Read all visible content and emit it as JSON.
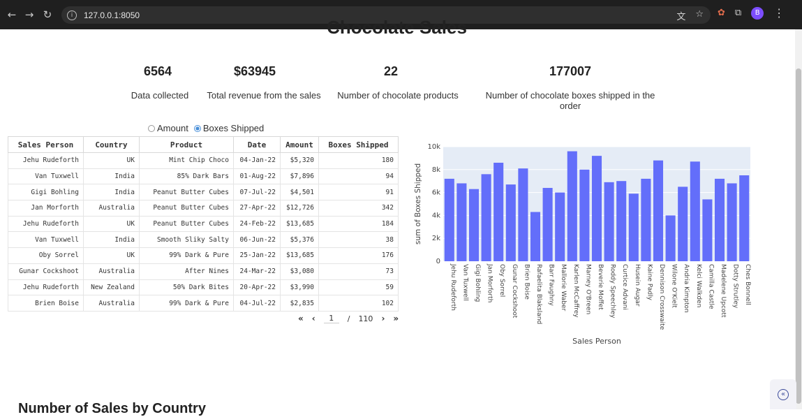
{
  "browser": {
    "url": "127.0.0.1:8050",
    "profile_initial": "B",
    "icons": [
      "back-icon",
      "forward-icon",
      "reload-icon",
      "info-icon",
      "translate-icon",
      "star-icon",
      "extension-icon",
      "puzzle-icon",
      "menu-icon"
    ]
  },
  "page": {
    "title": "Chocolate Sales",
    "bottom_heading": "Number of Sales by Country"
  },
  "stats": [
    {
      "value": "6564",
      "label": "Data collected"
    },
    {
      "value": "$63945",
      "label": "Total revenue from the sales"
    },
    {
      "value": "22",
      "label": "Number of chocolate products"
    },
    {
      "value": "177007",
      "label": "Number of chocolate boxes shipped in the order"
    }
  ],
  "radio": {
    "options": [
      "Amount",
      "Boxes Shipped"
    ],
    "selected": "Boxes Shipped"
  },
  "table": {
    "headers": [
      "Sales Person",
      "Country",
      "Product",
      "Date",
      "Amount",
      "Boxes Shipped"
    ],
    "rows": [
      [
        "Jehu Rudeforth",
        "UK",
        "Mint Chip Choco",
        "04-Jan-22",
        "$5,320",
        "180"
      ],
      [
        "Van Tuxwell",
        "India",
        "85% Dark Bars",
        "01-Aug-22",
        "$7,896",
        "94"
      ],
      [
        "Gigi Bohling",
        "India",
        "Peanut Butter Cubes",
        "07-Jul-22",
        "$4,501",
        "91"
      ],
      [
        "Jan Morforth",
        "Australia",
        "Peanut Butter Cubes",
        "27-Apr-22",
        "$12,726",
        "342"
      ],
      [
        "Jehu Rudeforth",
        "UK",
        "Peanut Butter Cubes",
        "24-Feb-22",
        "$13,685",
        "184"
      ],
      [
        "Van Tuxwell",
        "India",
        "Smooth Sliky Salty",
        "06-Jun-22",
        "$5,376",
        "38"
      ],
      [
        "Oby Sorrel",
        "UK",
        "99% Dark & Pure",
        "25-Jan-22",
        "$13,685",
        "176"
      ],
      [
        "Gunar Cockshoot",
        "Australia",
        "After Nines",
        "24-Mar-22",
        "$3,080",
        "73"
      ],
      [
        "Jehu Rudeforth",
        "New Zealand",
        "50% Dark Bites",
        "20-Apr-22",
        "$3,990",
        "59"
      ],
      [
        "Brien Boise",
        "Australia",
        "99% Dark & Pure",
        "04-Jul-22",
        "$2,835",
        "102"
      ]
    ]
  },
  "pager": {
    "first": "«",
    "prev": "‹",
    "current": "1",
    "sep": "/",
    "total": "110",
    "next": "›",
    "last": "»"
  },
  "chart_data": {
    "type": "bar",
    "xlabel": "Sales Person",
    "ylabel": "sum of Boxes Shipped",
    "ylim": [
      0,
      10000
    ],
    "yticks": [
      0,
      2000,
      4000,
      6000,
      8000,
      10000
    ],
    "ytick_labels": [
      "0",
      "2k",
      "4k",
      "6k",
      "8k",
      "10k"
    ],
    "grid": true,
    "bar_color": "#636efa",
    "plot_bg": "#e5ecf6",
    "categories": [
      "Jehu Rudeforth",
      "Van Tuxwell",
      "Gigi Bohling",
      "Jan Morforth",
      "Oby Sorrel",
      "Gunar Cockshoot",
      "Brien Boise",
      "Rafaelita Blaksland",
      "Barr Faughny",
      "Mallorie Waber",
      "Karlen McCaffrey",
      "Marney O'Breen",
      "Beverie Moffet",
      "Roddy Speechley",
      "Curtice Advani",
      "Husein Augar",
      "Kaine Padly",
      "Dennison Crosswaite",
      "Wilone O'Kielt",
      "Andria Kimpton",
      "Kelci Walkden",
      "Camilla Castle",
      "Madelene Upcott",
      "Dotty Strutley",
      "Ches Bonnell"
    ],
    "values": [
      7200,
      6800,
      6300,
      7600,
      8600,
      6700,
      8100,
      4300,
      6400,
      6000,
      9600,
      8000,
      9200,
      6900,
      7000,
      5900,
      7200,
      8800,
      4000,
      6500,
      8700,
      5400,
      7200,
      6800,
      7500
    ]
  }
}
